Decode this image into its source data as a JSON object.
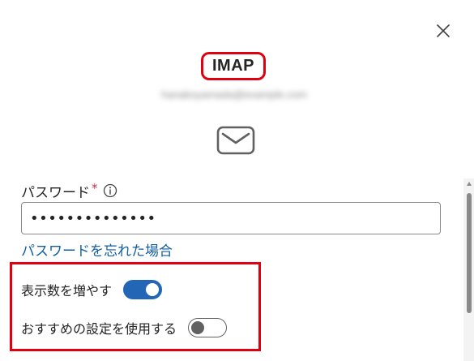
{
  "dialog": {
    "title": "IMAP",
    "account_email": "hanakoyamada@example.com",
    "close_icon": "close-icon",
    "mail_icon": "mail-icon"
  },
  "password": {
    "label": "パスワード",
    "required_mark": "*",
    "info_icon": "info-icon",
    "value": "••••••••••••••",
    "forgot_link": "パスワードを忘れた場合"
  },
  "toggles": [
    {
      "label": "表示数を増やす",
      "state": "on"
    },
    {
      "label": "おすすめの設定を使用する",
      "state": "off"
    }
  ],
  "colors": {
    "accent": "#2266b5",
    "link": "#115ea3",
    "highlight": "#e0000f",
    "required": "#c4314b"
  }
}
